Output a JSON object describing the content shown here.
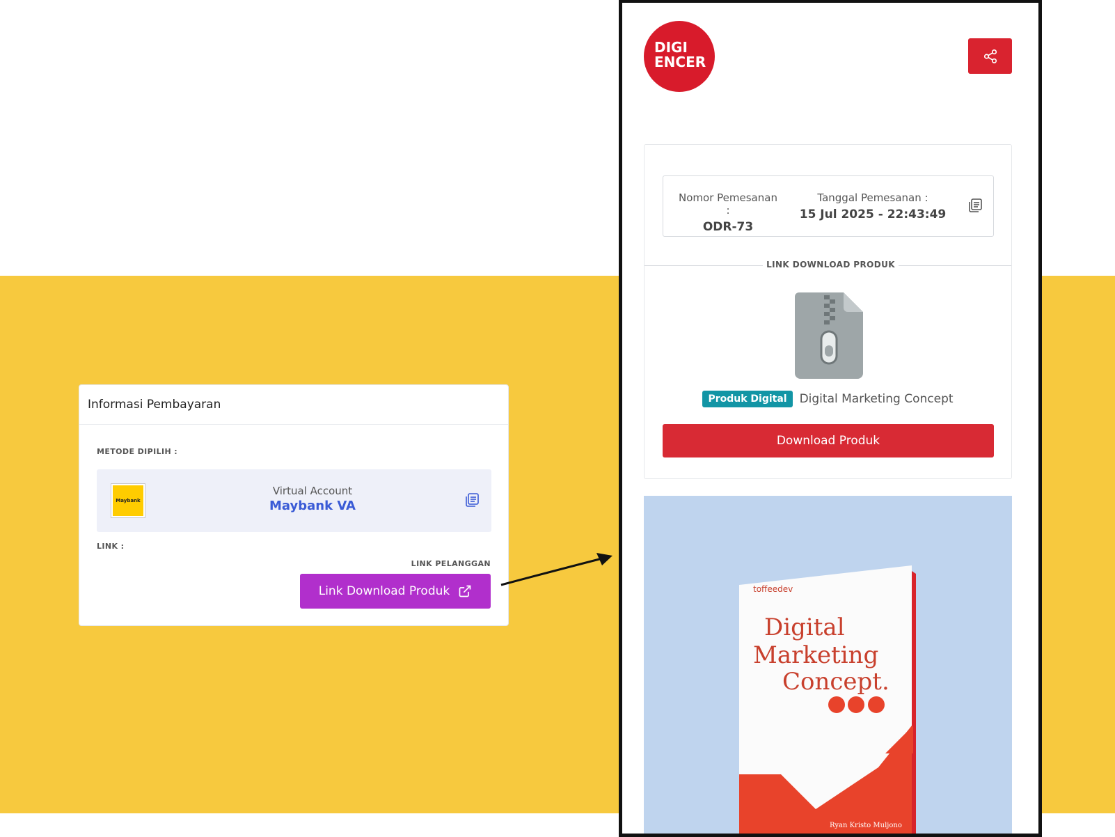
{
  "payment": {
    "title": "Informasi Pembayaran",
    "method_label": "METODE DIPILIH :",
    "method_type": "Virtual Account",
    "method_name": "Maybank VA",
    "bank_logo_text": "Maybank",
    "link_label": "LINK :",
    "customer_link_label": "LINK PELANGGAN",
    "download_link_button": "Link Download Produk"
  },
  "phone": {
    "brand_line1": "DIGI",
    "brand_line2": "ENCER",
    "order_number_label": "Nomor Pemesanan :",
    "order_number": "ODR-73",
    "order_date_label": "Tanggal Pemesanan :",
    "order_date": "15 Jul 2025 - 22:43:49",
    "section_label": "LINK DOWNLOAD PRODUK",
    "product_badge": "Produk Digital",
    "product_name": "Digital Marketing Concept",
    "download_button": "Download Produk"
  },
  "book_cover": {
    "publisher": "toffeedev",
    "title_line1": "Digital",
    "title_line2": "Marketing",
    "title_line3": "Concept.",
    "author": "Ryan Kristo Muljono"
  },
  "colors": {
    "yellow": "#f7c93e",
    "purple": "#b12fcc",
    "brand_red": "#d81b2b",
    "teal_badge": "#1295a5",
    "link_blue": "#3a5bd6"
  }
}
